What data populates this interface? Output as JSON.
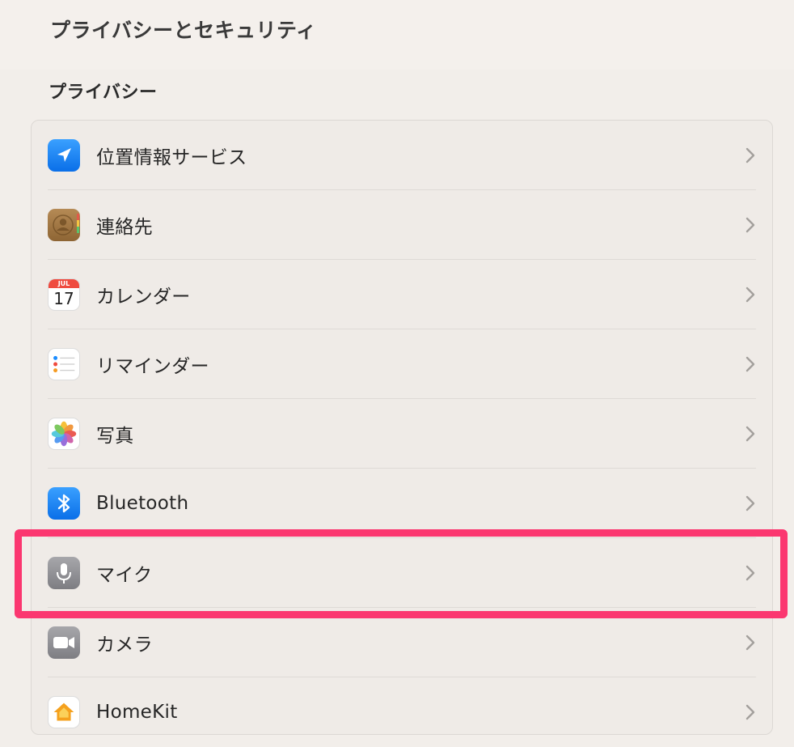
{
  "window": {
    "title": "プライバシーとセキュリティ"
  },
  "section": {
    "title": "プライバシー"
  },
  "items": [
    {
      "label": "位置情報サービス",
      "icon": "location-arrow-icon"
    },
    {
      "label": "連絡先",
      "icon": "contacts-icon"
    },
    {
      "label": "カレンダー",
      "icon": "calendar-icon",
      "calendar_month": "JUL",
      "calendar_day": "17"
    },
    {
      "label": "リマインダー",
      "icon": "reminders-icon"
    },
    {
      "label": "写真",
      "icon": "photos-icon"
    },
    {
      "label": "Bluetooth",
      "icon": "bluetooth-icon"
    },
    {
      "label": "マイク",
      "icon": "microphone-icon",
      "highlighted": true
    },
    {
      "label": "カメラ",
      "icon": "camera-icon"
    },
    {
      "label": "HomeKit",
      "icon": "home-icon"
    }
  ],
  "colors": {
    "background": "#f2eeea",
    "highlight": "#fb3770",
    "accent_blue": "#1a8cff"
  }
}
